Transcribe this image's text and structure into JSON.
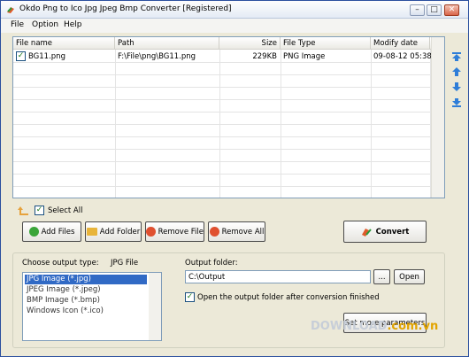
{
  "window": {
    "title": "Okdo Png to Ico Jpg Jpeg Bmp Converter [Registered]"
  },
  "menu": {
    "file": "File",
    "option": "Option",
    "help": "Help"
  },
  "filelist": {
    "columns": [
      "File name",
      "Path",
      "Size",
      "File Type",
      "Modify date"
    ],
    "rows": [
      {
        "name": "BG11.png",
        "path": "F:\\File\\png\\BG11.png",
        "size": "229KB",
        "type": "PNG Image",
        "date": "09-08-12 05:38",
        "checked": true
      }
    ]
  },
  "select_all": {
    "label": "Select All",
    "checked": true
  },
  "buttons": {
    "add_files": "Add Files",
    "add_folder": "Add Folder",
    "remove_file": "Remove File",
    "remove_all": "Remove All",
    "convert": "Convert",
    "browse": "...",
    "open": "Open",
    "more_params": "Set more parameters"
  },
  "output": {
    "choose_label": "Choose output type:",
    "choose_value": "JPG File",
    "formats": [
      "JPG Image (*.jpg)",
      "JPEG Image (*.jpeg)",
      "BMP Image (*.bmp)",
      "Windows Icon (*.ico)"
    ],
    "selected_index": 0,
    "folder_label": "Output folder:",
    "folder_value": "C:\\Output",
    "open_after_label": "Open the output folder after conversion finished",
    "open_after_checked": true
  },
  "watermark": {
    "brand": "DOWNLOAD",
    "suffix": ".com.vn"
  },
  "colors": {
    "title_bar": "#e4ebf5",
    "selection": "#316ac5",
    "arrow_blue": "#2f7ed8"
  },
  "icons": [
    "app-icon",
    "up-folder-icon",
    "add-icon",
    "folder-icon",
    "remove-icon",
    "remove-all-icon",
    "convert-icon",
    "move-top-icon",
    "move-up-icon",
    "move-down-icon",
    "move-bottom-icon"
  ]
}
